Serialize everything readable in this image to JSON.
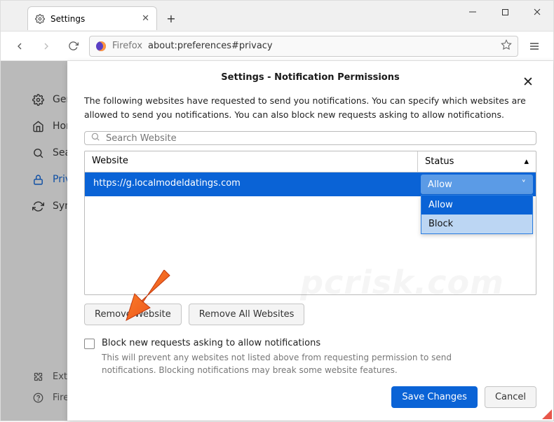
{
  "tab": {
    "title": "Settings"
  },
  "url": {
    "protocol_label": "Firefox",
    "address": "about:preferences#privacy"
  },
  "sidebar": {
    "items": [
      {
        "label": "General"
      },
      {
        "label": "Home"
      },
      {
        "label": "Search"
      },
      {
        "label": "Privacy & Security"
      },
      {
        "label": "Sync"
      }
    ],
    "bottom": [
      {
        "label": "Extensions & Themes"
      },
      {
        "label": "Firefox Support"
      }
    ]
  },
  "modal": {
    "title": "Settings - Notification Permissions",
    "description": "The following websites have requested to send you notifications. You can specify which websites are allowed to send you notifications. You can also block new requests asking to allow notifications.",
    "search_placeholder": "Search Website",
    "col_website": "Website",
    "col_status": "Status",
    "row_url": "https://g.localmodeldatings.com",
    "row_status": "Allow",
    "dropdown": {
      "opt_allow": "Allow",
      "opt_block": "Block"
    },
    "remove_website": "Remove Website",
    "remove_all": "Remove All Websites",
    "block_new_label": "Block new requests asking to allow notifications",
    "block_new_help": "This will prevent any websites not listed above from requesting permission to send notifications. Blocking notifications may break some website features.",
    "save": "Save Changes",
    "cancel": "Cancel"
  },
  "watermark": "pcrisk.com"
}
